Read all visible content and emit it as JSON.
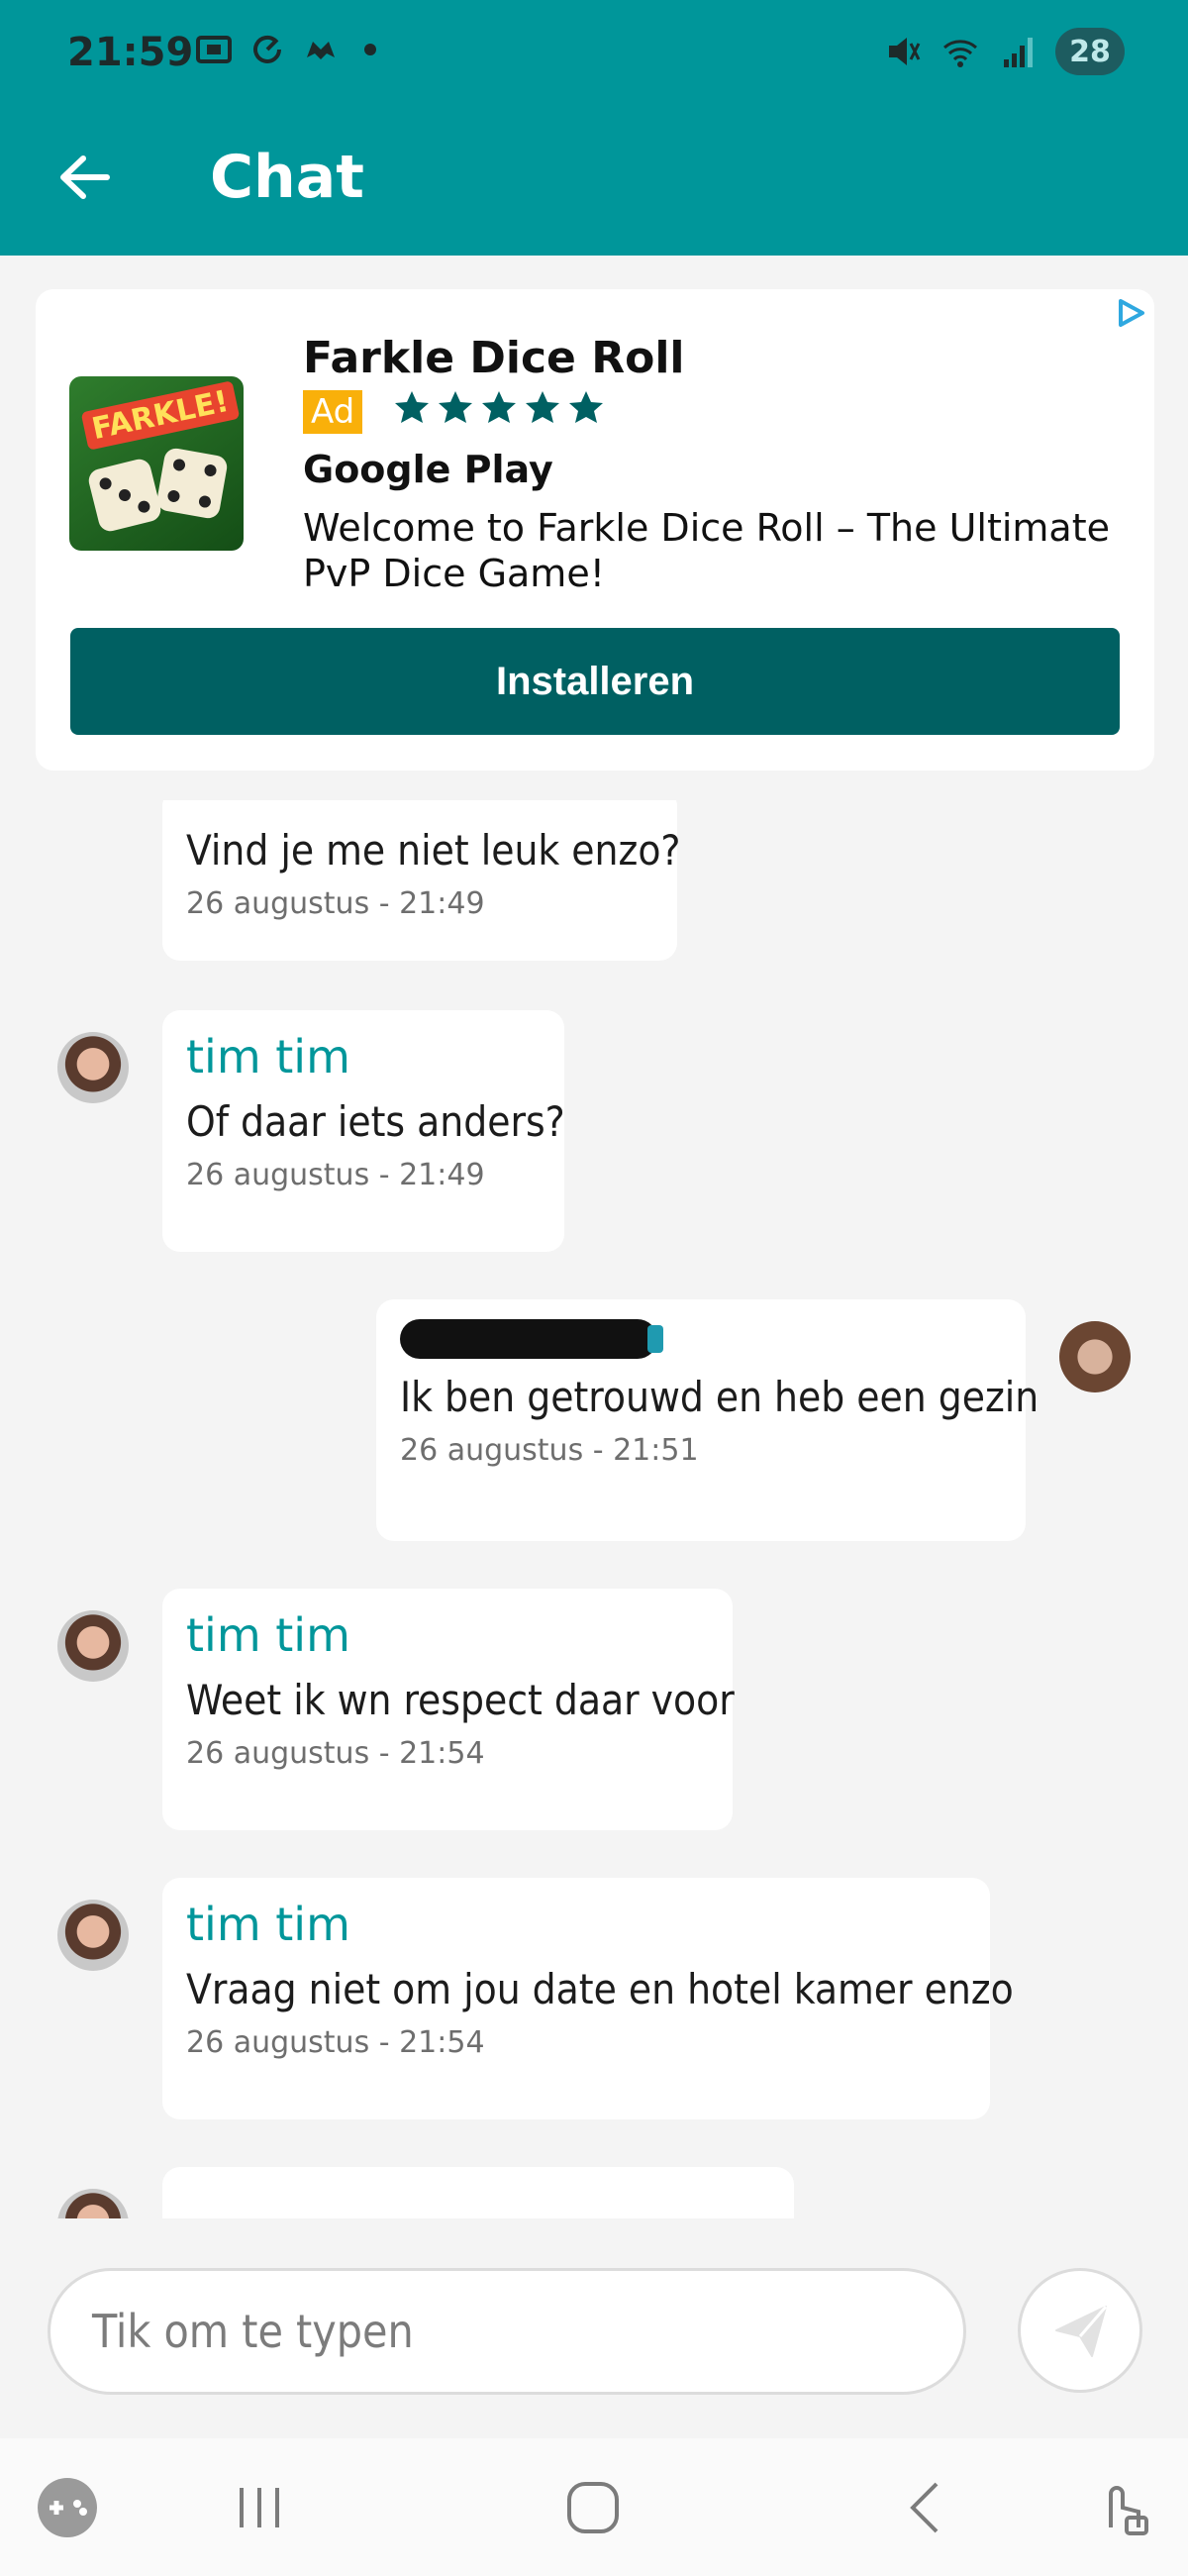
{
  "status_bar": {
    "time": "21:59",
    "battery": "28",
    "left_icons": [
      "screenshot-icon",
      "sync-icon",
      "game-icon",
      "dot-icon"
    ],
    "right_icons": [
      "mute-icon",
      "wifi-icon",
      "signal-icon"
    ]
  },
  "app_bar": {
    "title": "Chat",
    "back_icon": "arrow-left-icon"
  },
  "ad": {
    "title": "Farkle Dice Roll",
    "badge": "Ad",
    "rating_stars": 5,
    "store": "Google Play",
    "description": "Welcome to Farkle Dice Roll – The Ultimate PvP Dice Game!",
    "logo_text": "FARKLE!",
    "install_label": "Installeren",
    "colors": {
      "button": "#006062",
      "badge": "#f9b00a",
      "stars": "#006062"
    }
  },
  "messages": [
    {
      "side": "left",
      "sender": "",
      "text": "Vind je me niet leuk enzo?",
      "time": "26 augustus - 21:49"
    },
    {
      "side": "left",
      "sender": "tim tim",
      "text": "Of daar iets anders?",
      "time": "26 augustus - 21:49"
    },
    {
      "side": "right",
      "sender": "",
      "text": "Ik ben getrouwd en heb een gezin",
      "time": "26 augustus - 21:51"
    },
    {
      "side": "left",
      "sender": "tim tim",
      "text": "Weet ik wn respect daar voor",
      "time": "26 augustus - 21:54"
    },
    {
      "side": "left",
      "sender": "tim tim",
      "text": "Vraag niet om jou date en hotel kamer enzo",
      "time": "26 augustus - 21:54"
    }
  ],
  "input": {
    "placeholder": "Tik om te typen"
  },
  "theme": {
    "primary": "#00969a",
    "background": "#f4f4f4",
    "sender_color": "#00969a"
  },
  "nav_bar": {
    "icons": [
      "game-launcher-icon",
      "recent-apps-icon",
      "home-icon",
      "back-icon",
      "touch-lock-icon"
    ]
  }
}
